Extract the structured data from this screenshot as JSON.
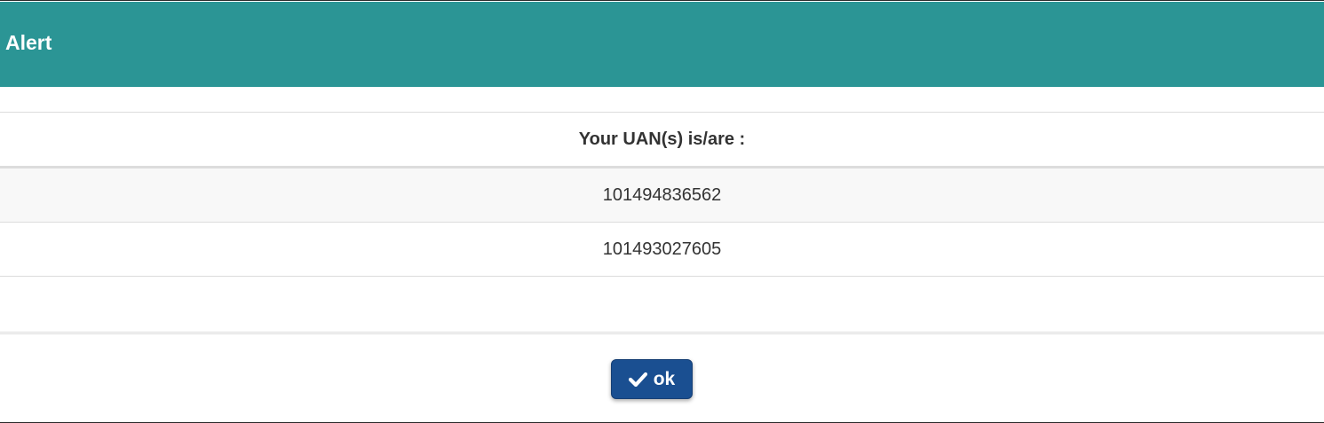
{
  "dialog": {
    "title": "Alert"
  },
  "table": {
    "header": "Your UAN(s) is/are :",
    "rows": [
      "101494836562",
      "101493027605"
    ]
  },
  "footer": {
    "ok_label": "ok",
    "ok_icon": "check-icon"
  },
  "colors": {
    "header_bg": "#2b9595",
    "button_bg": "#1a4f91"
  }
}
